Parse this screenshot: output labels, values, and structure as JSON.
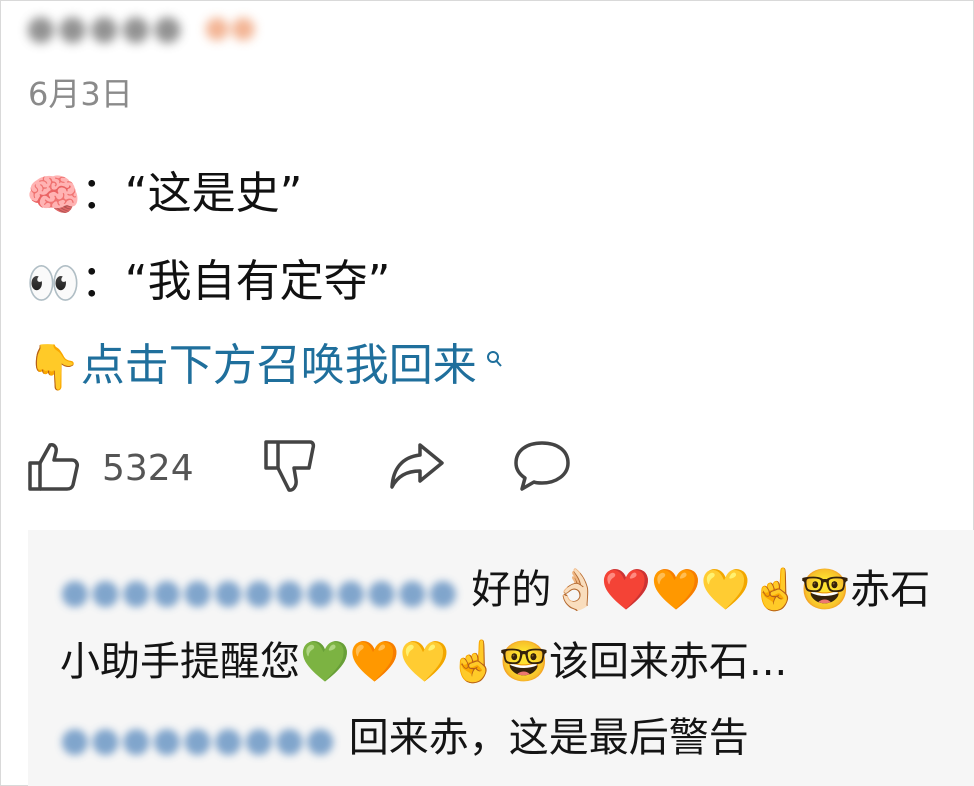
{
  "post": {
    "author_blurred": "●●●●●",
    "badge_blurred": "●●",
    "date": "6月3日",
    "lines": [
      {
        "emoji": "🧠",
        "text": "：“这是史”"
      },
      {
        "emoji": "👀",
        "text": "：“我自有定夺”"
      }
    ],
    "link": {
      "emoji": "👇",
      "text": "点击下方召唤我回来",
      "icon": "search-icon"
    }
  },
  "actions": {
    "like_count": "5324",
    "icons": [
      "thumbs-up-icon",
      "thumbs-down-icon",
      "share-icon",
      "comment-icon"
    ]
  },
  "comments": [
    {
      "author_blurred": "●●●●●●●●●●●●●",
      "text": "好的👌🏻❤️🧡💛☝️🤓赤石"
    },
    {
      "author_blurred": "",
      "text": "小助手提醒您💚🧡💛☝️🤓该回来赤石..."
    },
    {
      "author_blurred": "●●●●●●●●●",
      "text": "回来赤，这是最后警告"
    }
  ],
  "colors": {
    "link": "#1f6f9c",
    "comment_bg": "#f6f6f6",
    "meta": "#8a8a8a"
  }
}
